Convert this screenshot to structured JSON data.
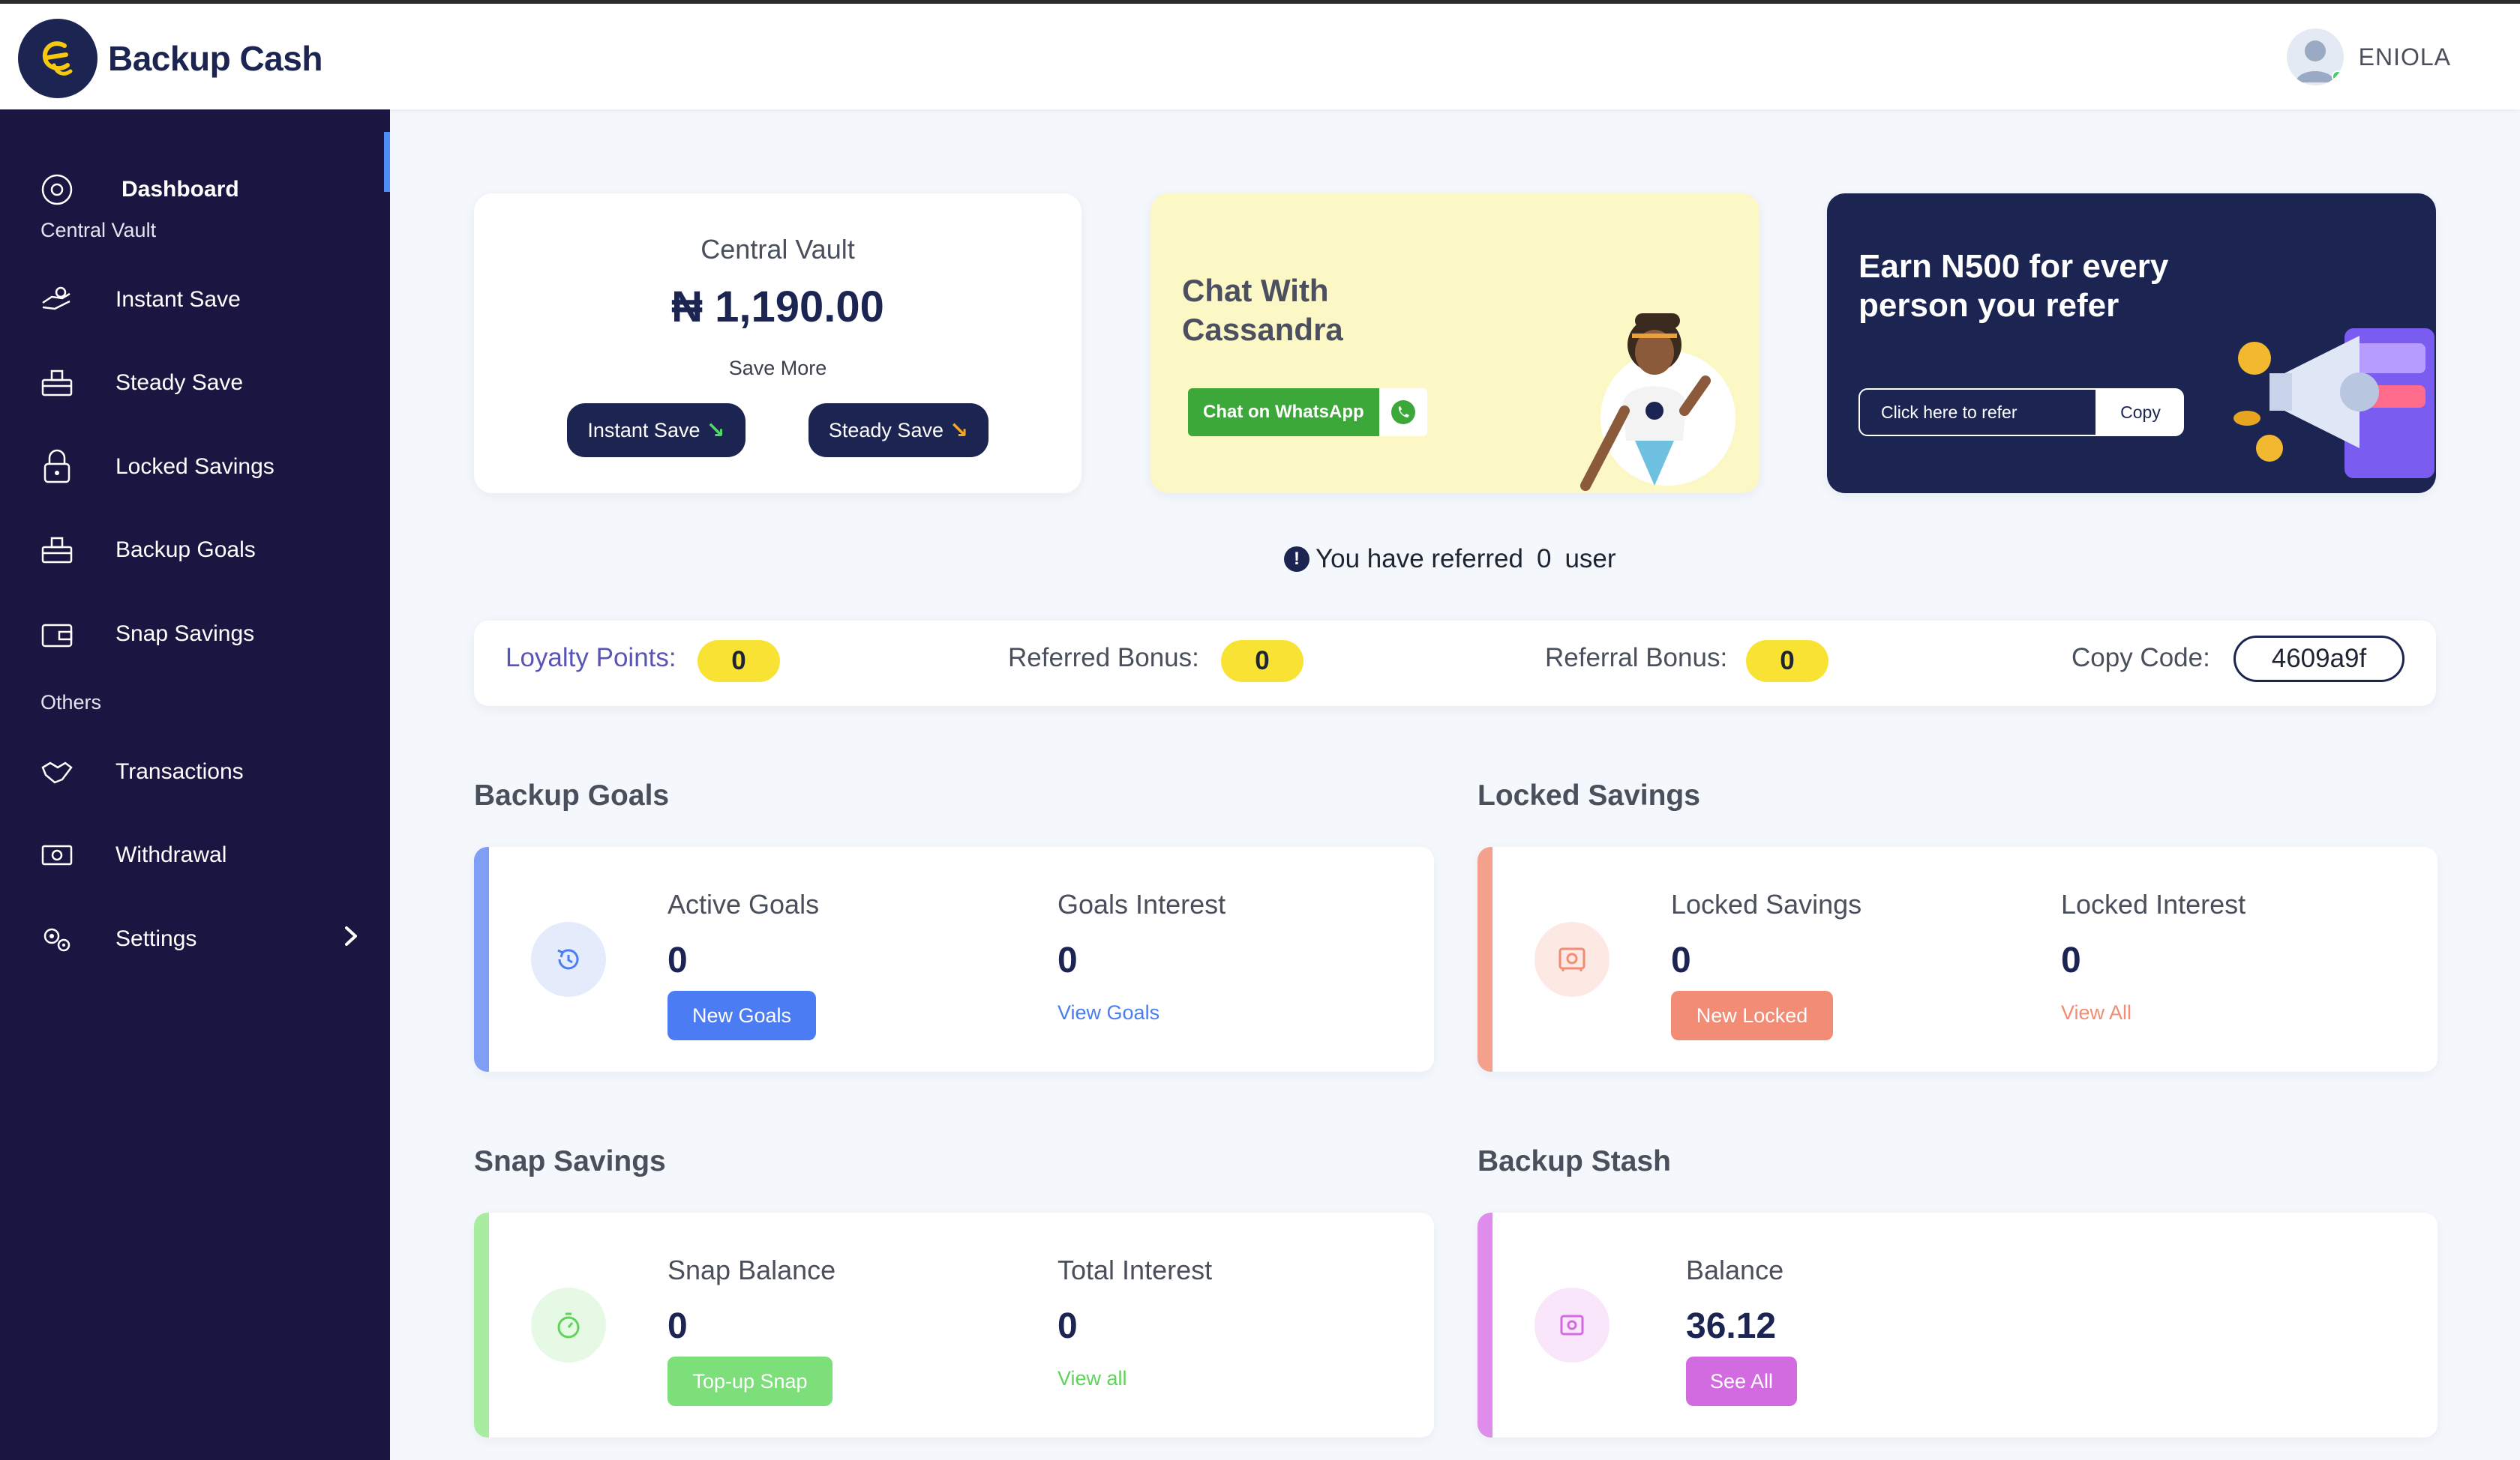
{
  "app": {
    "name": "Backup Cash"
  },
  "user": {
    "name": "ENIOLA"
  },
  "sidebar": {
    "dashboard": "Dashboard",
    "section_central": "Central Vault",
    "items_central": [
      {
        "label": "Instant Save",
        "icon": "hand-coin-icon"
      },
      {
        "label": "Steady Save",
        "icon": "box-icon"
      },
      {
        "label": "Locked Savings",
        "icon": "lock-icon"
      },
      {
        "label": "Backup Goals",
        "icon": "box-icon"
      },
      {
        "label": "Snap Savings",
        "icon": "wallet-icon"
      }
    ],
    "section_others": "Others",
    "items_others": [
      {
        "label": "Transactions",
        "icon": "handshake-icon"
      },
      {
        "label": "Withdrawal",
        "icon": "cash-icon"
      },
      {
        "label": "Settings",
        "icon": "gears-icon"
      }
    ]
  },
  "vault": {
    "title": "Central Vault",
    "amount": "₦ 1,190.00",
    "save_more": "Save More",
    "instant_save": "Instant Save",
    "steady_save": "Steady Save"
  },
  "chat": {
    "title": "Chat With Cassandra",
    "whatsapp_label": "Chat on WhatsApp"
  },
  "refer": {
    "title": "Earn N500 for every person you refer",
    "input_placeholder": "Click here to refer",
    "copy": "Copy"
  },
  "referred": {
    "prefix": "You have referred",
    "count": "0",
    "suffix": "user"
  },
  "loyalty": {
    "points_label": "Loyalty Points:",
    "points_value": "0",
    "referred_bonus_label": "Referred Bonus:",
    "referred_bonus_value": "0",
    "referral_bonus_label": "Referral Bonus:",
    "referral_bonus_value": "0",
    "copy_code_label": "Copy Code:",
    "code": "4609a9f"
  },
  "sections": {
    "backup_goals": {
      "title": "Backup Goals",
      "left_label": "Active Goals",
      "left_value": "0",
      "button": "New Goals",
      "right_label": "Goals Interest",
      "right_value": "0",
      "link": "View Goals",
      "accent": "#4b7cf3"
    },
    "locked_savings": {
      "title": "Locked Savings",
      "left_label": "Locked Savings",
      "left_value": "0",
      "button": "New Locked",
      "right_label": "Locked Interest",
      "right_value": "0",
      "link": "View All",
      "accent": "#f28c74"
    },
    "snap_savings": {
      "title": "Snap Savings",
      "left_label": "Snap Balance",
      "left_value": "0",
      "button": "Top-up Snap",
      "right_label": "Total Interest",
      "right_value": "0",
      "link": "View all",
      "accent": "#7ddf7a"
    },
    "backup_stash": {
      "title": "Backup Stash",
      "left_label": "Balance",
      "left_value": "36.12",
      "button": "See All",
      "accent": "#d36be0"
    }
  }
}
